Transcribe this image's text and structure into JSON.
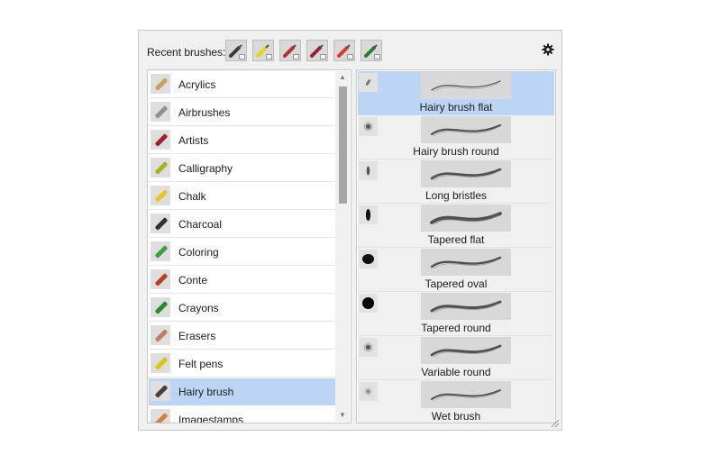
{
  "header": {
    "recent_label": "Recent brushes:",
    "recent_brushes": [
      {
        "icon": "flat-brush-icon",
        "color": "#3a3a3a"
      },
      {
        "icon": "felt-pen-icon",
        "color": "#e8d61a"
      },
      {
        "icon": "airbrush-icon",
        "color": "#b0302a"
      },
      {
        "icon": "artist-brush-icon",
        "color": "#9b1b3a"
      },
      {
        "icon": "calligraphy-pen-icon",
        "color": "#d6402a"
      },
      {
        "icon": "crayon-icon",
        "color": "#2f7a2f"
      }
    ],
    "settings_icon": "gear-icon"
  },
  "categories": [
    {
      "label": "Acrylics",
      "color": "#c8a060"
    },
    {
      "label": "Airbrushes",
      "color": "#909090"
    },
    {
      "label": "Artists",
      "color": "#a02030"
    },
    {
      "label": "Calligraphy",
      "color": "#a8b020"
    },
    {
      "label": "Chalk",
      "color": "#e8c820"
    },
    {
      "label": "Charcoal",
      "color": "#303030"
    },
    {
      "label": "Coloring",
      "color": "#40a040"
    },
    {
      "label": "Conte",
      "color": "#b84020"
    },
    {
      "label": "Crayons",
      "color": "#2a8a2a"
    },
    {
      "label": "Erasers",
      "color": "#c08060"
    },
    {
      "label": "Felt pens",
      "color": "#d8c810"
    },
    {
      "label": "Hairy brush",
      "color": "#404040"
    },
    {
      "label": "Imagestamps",
      "color": "#d08040"
    }
  ],
  "selected_category": "Hairy brush",
  "brushes": [
    {
      "label": "Hairy brush flat",
      "tip": "flat"
    },
    {
      "label": "Hairy brush round",
      "tip": "round-soft"
    },
    {
      "label": "Long bristles",
      "tip": "bristle"
    },
    {
      "label": "Tapered flat",
      "tip": "tapered-flat"
    },
    {
      "label": "Tapered oval",
      "tip": "oval"
    },
    {
      "label": "Tapered round",
      "tip": "round-hard"
    },
    {
      "label": "Variable round",
      "tip": "round-soft"
    },
    {
      "label": "Wet brush",
      "tip": "soft-small"
    }
  ],
  "selected_brush": "Hairy brush flat"
}
